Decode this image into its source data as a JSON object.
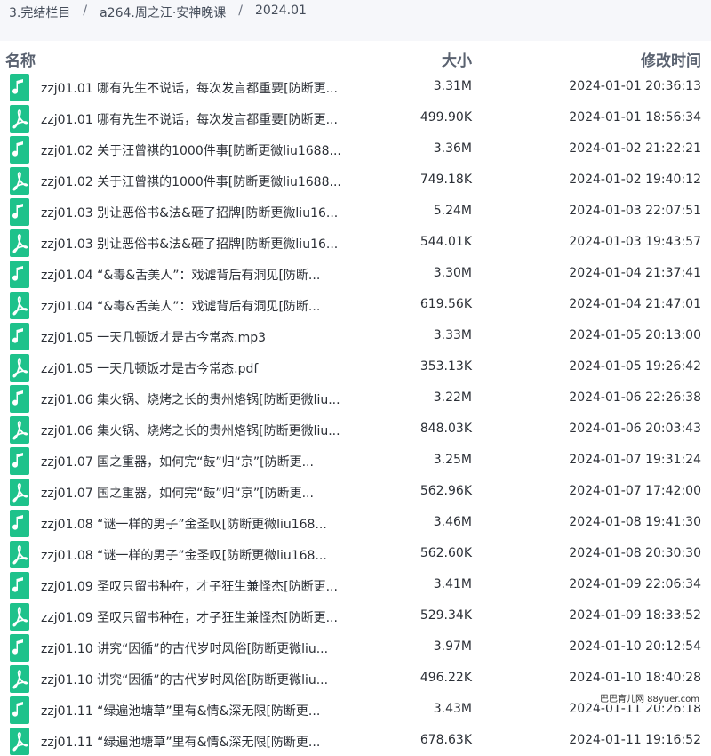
{
  "breadcrumb": {
    "items": [
      "3.完结栏目",
      "a264.周之江·安神晚课",
      "2024.01"
    ],
    "separator": "/"
  },
  "header": {
    "name": "名称",
    "size": "大小",
    "time": "修改时间"
  },
  "colors": {
    "icon_green": "#1ec28b",
    "header_text": "#5a6270"
  },
  "files": [
    {
      "name": "zzj01.01 哪有先生不说话，每次发言都重要[防断更...",
      "size": "3.31M",
      "time": "2024-01-01 20:36:13",
      "icon": "audio-file-icon"
    },
    {
      "name": "zzj01.01 哪有先生不说话，每次发言都重要[防断更...",
      "size": "499.90K",
      "time": "2024-01-01 18:56:34",
      "icon": "pdf-file-icon"
    },
    {
      "name": "zzj01.02 关于汪曾祺的1000件事[防断更微liu1688...",
      "size": "3.36M",
      "time": "2024-01-02 21:22:21",
      "icon": "audio-file-icon"
    },
    {
      "name": "zzj01.02 关于汪曾祺的1000件事[防断更微liu1688...",
      "size": "749.18K",
      "time": "2024-01-02 19:40:12",
      "icon": "pdf-file-icon"
    },
    {
      "name": "zzj01.03 别让恶俗书&法&砸了招牌[防断更微liu16...",
      "size": "5.24M",
      "time": "2024-01-03 22:07:51",
      "icon": "audio-file-icon"
    },
    {
      "name": "zzj01.03 别让恶俗书&法&砸了招牌[防断更微liu16...",
      "size": "544.01K",
      "time": "2024-01-03 19:43:57",
      "icon": "pdf-file-icon"
    },
    {
      "name": "zzj01.04 “&毒&舌美人”：戏谑背后有洞见[防断...",
      "size": "3.30M",
      "time": "2024-01-04 21:37:41",
      "icon": "audio-file-icon"
    },
    {
      "name": "zzj01.04 “&毒&舌美人”：戏谑背后有洞见[防断...",
      "size": "619.56K",
      "time": "2024-01-04 21:47:01",
      "icon": "pdf-file-icon"
    },
    {
      "name": "zzj01.05 一天几顿饭才是古今常态.mp3",
      "size": "3.33M",
      "time": "2024-01-05 20:13:00",
      "icon": "audio-file-icon"
    },
    {
      "name": "zzj01.05 一天几顿饭才是古今常态.pdf",
      "size": "353.13K",
      "time": "2024-01-05 19:26:42",
      "icon": "pdf-file-icon"
    },
    {
      "name": "zzj01.06 集火锅、烧烤之长的贵州烙锅[防断更微liu...",
      "size": "3.22M",
      "time": "2024-01-06 22:26:38",
      "icon": "audio-file-icon"
    },
    {
      "name": "zzj01.06 集火锅、烧烤之长的贵州烙锅[防断更微liu...",
      "size": "848.03K",
      "time": "2024-01-06 20:03:43",
      "icon": "pdf-file-icon"
    },
    {
      "name": "zzj01.07 国之重器，如何完“鼓”归“京”[防断更...",
      "size": "3.25M",
      "time": "2024-01-07 19:31:24",
      "icon": "audio-file-icon"
    },
    {
      "name": "zzj01.07 国之重器，如何完“鼓”归“京”[防断更...",
      "size": "562.96K",
      "time": "2024-01-07 17:42:00",
      "icon": "pdf-file-icon"
    },
    {
      "name": "zzj01.08 “谜一样的男子”金圣叹[防断更微liu168...",
      "size": "3.46M",
      "time": "2024-01-08 19:41:30",
      "icon": "audio-file-icon"
    },
    {
      "name": "zzj01.08 “谜一样的男子”金圣叹[防断更微liu168...",
      "size": "562.60K",
      "time": "2024-01-08 20:30:30",
      "icon": "pdf-file-icon"
    },
    {
      "name": "zzj01.09 圣叹只留书种在，才子狂生兼怪杰[防断更...",
      "size": "3.41M",
      "time": "2024-01-09 22:06:34",
      "icon": "audio-file-icon"
    },
    {
      "name": "zzj01.09 圣叹只留书种在，才子狂生兼怪杰[防断更...",
      "size": "529.34K",
      "time": "2024-01-09 18:33:52",
      "icon": "pdf-file-icon"
    },
    {
      "name": "zzj01.10 讲究“因循”的古代岁时风俗[防断更微liu...",
      "size": "3.97M",
      "time": "2024-01-10 20:12:54",
      "icon": "audio-file-icon"
    },
    {
      "name": "zzj01.10 讲究“因循”的古代岁时风俗[防断更微liu...",
      "size": "496.22K",
      "time": "2024-01-10 18:40:28",
      "icon": "pdf-file-icon"
    },
    {
      "name": "zzj01.11 “绿遍池塘草”里有&情&深无限[防断更...",
      "size": "3.43M",
      "time": "2024-01-11 20:26:18",
      "icon": "audio-file-icon"
    },
    {
      "name": "zzj01.11 “绿遍池塘草”里有&情&深无限[防断更...",
      "size": "678.63K",
      "time": "2024-01-11 19:16:52",
      "icon": "pdf-file-icon"
    }
  ],
  "watermark": "巴巴育儿网 88yuer.com"
}
